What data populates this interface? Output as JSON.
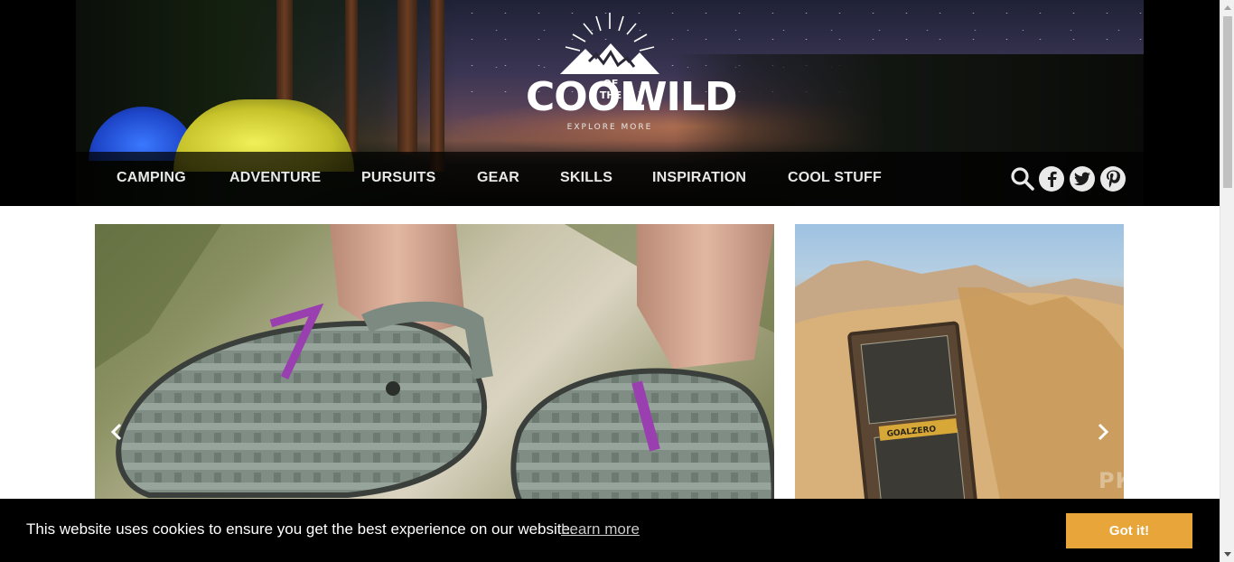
{
  "brand": {
    "logo_cool": "COOL",
    "logo_ofthe": "OF THE",
    "logo_wild": "WILD",
    "tagline": "EXPLORE MORE"
  },
  "nav": {
    "items": [
      {
        "label": "CAMPING"
      },
      {
        "label": "ADVENTURE"
      },
      {
        "label": "PURSUITS"
      },
      {
        "label": "GEAR"
      },
      {
        "label": "SKILLS"
      },
      {
        "label": "INSPIRATION"
      },
      {
        "label": "COOL STUFF"
      }
    ],
    "icons": [
      "search-icon",
      "facebook-icon",
      "twitter-icon",
      "pinterest-icon"
    ]
  },
  "carousel": {
    "prev_icon": "chevron-left-icon",
    "next_icon": "chevron-right-icon",
    "product_brand": "GOALZERO"
  },
  "cookie": {
    "message": "This website uses cookies to ensure you get the best experience on our website.",
    "link_label": "Learn more",
    "button_label": "Got it!"
  },
  "watermark": "РКИН",
  "colors": {
    "accent": "#e8a63a",
    "cookie_bg": "#000000",
    "nav_text": "#e8e8e8"
  }
}
